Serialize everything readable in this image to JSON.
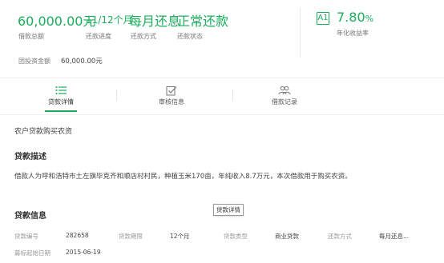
{
  "summary": {
    "amount": {
      "value": "60,000.00元",
      "label": "借款总额"
    },
    "progress": {
      "value": "11/12个月",
      "label": "还款进度"
    },
    "method": {
      "value": "每月还息",
      "label": "还款方式"
    },
    "status": {
      "value": "正常还款",
      "label": "还款状态"
    },
    "invested_label": "团投资金额",
    "invested_value": "60,000.00元"
  },
  "rating": {
    "grade": "A1",
    "rate": "7.80",
    "rate_unit": "%",
    "rate_label": "年化收益率"
  },
  "tabs": [
    {
      "label": "贷款详情",
      "icon": "list-icon",
      "active": true
    },
    {
      "label": "审核信息",
      "icon": "check-document-icon",
      "active": false
    },
    {
      "label": "借款记录",
      "icon": "users-icon",
      "active": false
    }
  ],
  "loan_purpose": "农户贷款购买农资",
  "description": {
    "title": "贷款描述",
    "text": "借款人为呼和浩特市土左旗毕克齐和顺店村村民，种植玉米170亩，年纯收入8.7万元，本次借款用于购买农资。"
  },
  "loan_info": {
    "title": "贷款信息",
    "tooltip": "贷款详情",
    "rows": [
      [
        {
          "label": "贷款编号",
          "value": "282658"
        },
        {
          "label": "贷款期限",
          "value": "12个月"
        },
        {
          "label": "贷款类型",
          "value": "商业贷款"
        },
        {
          "label": "还款方式",
          "value": "每月还息..."
        }
      ],
      [
        {
          "label": "募标起始日期",
          "value": "2015-06-19"
        }
      ]
    ]
  },
  "colors": {
    "accent": "#1aad5b"
  }
}
